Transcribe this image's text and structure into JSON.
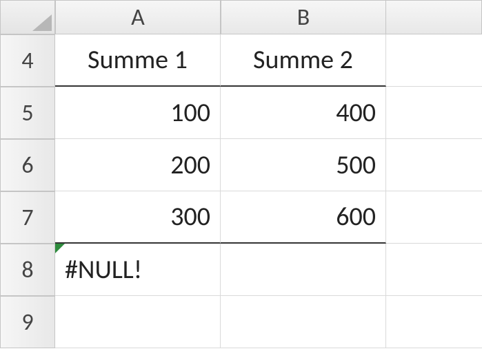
{
  "columns": {
    "A": "A",
    "B": "B"
  },
  "rows": {
    "r4": "4",
    "r5": "5",
    "r6": "6",
    "r7": "7",
    "r8": "8",
    "r9": "9"
  },
  "cells": {
    "A4": "Summe 1",
    "B4": "Summe 2",
    "A5": "100",
    "B5": "400",
    "A6": "200",
    "B6": "500",
    "A7": "300",
    "B7": "600",
    "A8": "#NULL!",
    "B8": "",
    "A9": "",
    "B9": ""
  }
}
